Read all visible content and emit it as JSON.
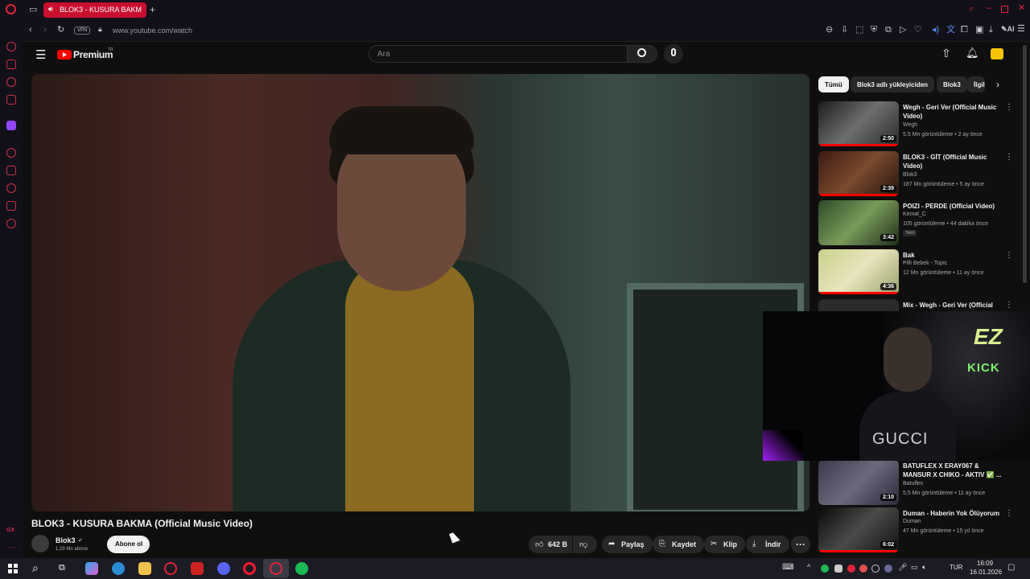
{
  "browser": {
    "tab_title": "BLOK3 - KUSURA BAKM",
    "new_tab": "+",
    "url": "www.youtube.com/watch",
    "vpn_label": "VPN",
    "ai_label": "AI"
  },
  "youtube": {
    "logo_text": "Premium",
    "logo_sup": "TR",
    "search_placeholder": "Ara",
    "video": {
      "title": "BLOK3 - KUSURA BAKMA (Official Music Video)",
      "channel": "Blok3",
      "subscribers": "1,29 Mn abone",
      "subscribe_label": "Abone ol",
      "likes": "642 B",
      "share_label": "Paylaş",
      "save_label": "Kaydet",
      "clip_label": "Klip",
      "download_label": "İndir"
    },
    "chips": [
      "Tümü",
      "Blok3 adlı yükleyiciden",
      "Blok3",
      "İlgili"
    ],
    "recommendations": [
      {
        "title": "Wegh - Geri Ver (Official Music Video)",
        "channel": "Wegh",
        "views": "5,5 Mn görüntüleme • 2 ay önce",
        "duration": "2:50"
      },
      {
        "title": "BLOK3 - GİT (Official Music Video)",
        "channel": "Blok3",
        "views": "187 Mn görüntüleme • 5 ay önce",
        "duration": "2:39"
      },
      {
        "title": "POIZI - PERDE (Official Video)",
        "channel": "Kemal_C",
        "views": "105 görüntüleme • 44 dakika önce",
        "duration": "3:42",
        "badge": "Yeni"
      },
      {
        "title": "Bak",
        "channel": "Pilli Bebek - Topic",
        "views": "12 Mn görüntüleme • 11 ay önce",
        "duration": "4:36"
      },
      {
        "title": "Mix - Wegh - Geri Ver (Official",
        "channel": "",
        "views": "",
        "duration": ""
      },
      {
        "title": "BATUFLEX X ERAY067 & MANSUR X CHIKO - AKTIV ✅ ...",
        "channel": "Batuflex",
        "views": "5,5 Mn görüntüleme • 11 ay önce",
        "duration": "2:10"
      },
      {
        "title": "Duman - Haberin Yok Ölüyorum",
        "channel": "Duman",
        "views": "47 Mn görüntüleme • 15 yıl önce",
        "duration": "6:02"
      }
    ]
  },
  "webcam": {
    "sign_top": "EZ",
    "sign_bottom": "KICK",
    "shirt_text": "GUCCI"
  },
  "taskbar": {
    "language": "TUR",
    "time": "16:09",
    "date": "16.01.2026"
  },
  "colors": {
    "accent": "#c8102e",
    "yt_red": "#ff0000",
    "bg": "#0f0f0f"
  }
}
